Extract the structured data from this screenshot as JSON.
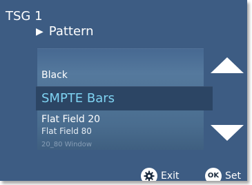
{
  "header": {
    "title": "TSG 1",
    "breadcrumb": "Pattern"
  },
  "pattern_list": {
    "items": [
      {
        "label": "Black",
        "selected": false
      },
      {
        "label": "SMPTE Bars",
        "selected": true
      },
      {
        "label": "Flat Field 20",
        "selected": false
      },
      {
        "label": "Flat Field 80",
        "selected": false
      },
      {
        "label": "20_80 Window",
        "selected": false
      }
    ]
  },
  "footer": {
    "exit_label": "Exit",
    "exit_icon": "gear-icon",
    "set_label": "Set",
    "set_icon_text": "OK"
  },
  "colors": {
    "background": "#3d5c83",
    "selected_text": "#7fd3f2",
    "selected_row": "#2c4564"
  }
}
